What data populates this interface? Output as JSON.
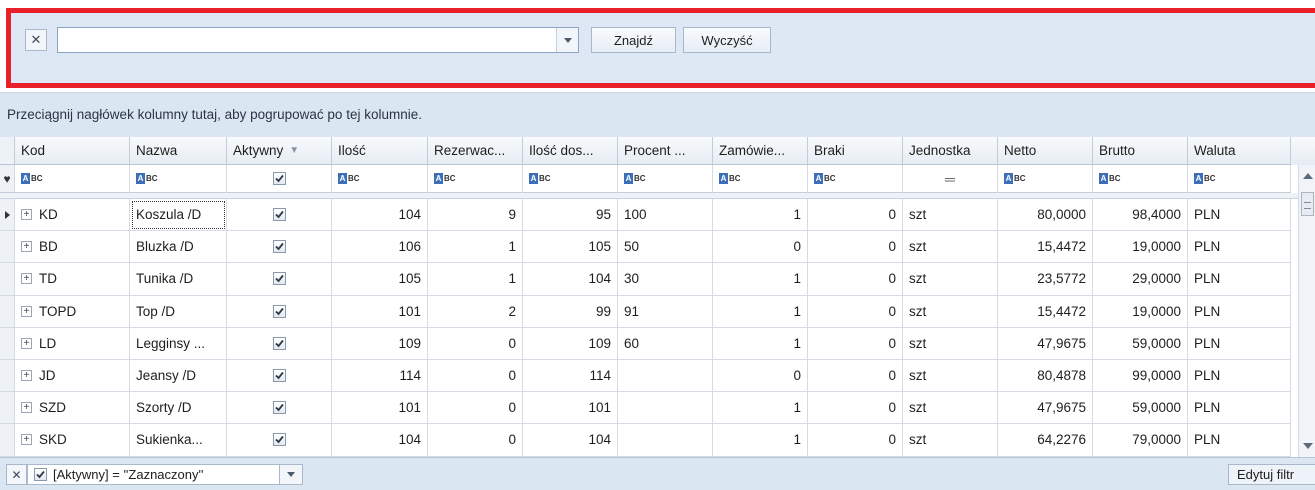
{
  "search": {
    "value": "",
    "find_label": "Znajdź",
    "clear_label": "Wyczyść"
  },
  "group_panel": {
    "hint": "Przeciągnij nagłówek kolumny tutaj, aby pogrupować po tej kolumnie."
  },
  "columns": {
    "kod": "Kod",
    "nazwa": "Nazwa",
    "aktywny": "Aktywny",
    "ilosc": "Ilość",
    "rezerwacje": "Rezerwac...",
    "ilosc_dost": "Ilość dos...",
    "procent": "Procent ...",
    "zamowienia": "Zamówie...",
    "braki": "Braki",
    "jednostka": "Jednostka",
    "netto": "Netto",
    "brutto": "Brutto",
    "waluta": "Waluta"
  },
  "rows": [
    {
      "kod": "KD",
      "nazwa": "Koszula /D",
      "aktywny": true,
      "ilosc": "104",
      "rezerwacje": "9",
      "ilosc_dost": "95",
      "procent": "100",
      "zamowienia": "1",
      "braki": "0",
      "jednostka": "szt",
      "netto": "80,0000",
      "brutto": "98,4000",
      "waluta": "PLN"
    },
    {
      "kod": "BD",
      "nazwa": "Bluzka /D",
      "aktywny": true,
      "ilosc": "106",
      "rezerwacje": "1",
      "ilosc_dost": "105",
      "procent": "50",
      "zamowienia": "0",
      "braki": "0",
      "jednostka": "szt",
      "netto": "15,4472",
      "brutto": "19,0000",
      "waluta": "PLN"
    },
    {
      "kod": "TD",
      "nazwa": "Tunika /D",
      "aktywny": true,
      "ilosc": "105",
      "rezerwacje": "1",
      "ilosc_dost": "104",
      "procent": "30",
      "zamowienia": "1",
      "braki": "0",
      "jednostka": "szt",
      "netto": "23,5772",
      "brutto": "29,0000",
      "waluta": "PLN"
    },
    {
      "kod": "TOPD",
      "nazwa": "Top /D",
      "aktywny": true,
      "ilosc": "101",
      "rezerwacje": "2",
      "ilosc_dost": "99",
      "procent": "91",
      "zamowienia": "1",
      "braki": "0",
      "jednostka": "szt",
      "netto": "15,4472",
      "brutto": "19,0000",
      "waluta": "PLN"
    },
    {
      "kod": "LD",
      "nazwa": "Legginsy ...",
      "aktywny": true,
      "ilosc": "109",
      "rezerwacje": "0",
      "ilosc_dost": "109",
      "procent": "60",
      "zamowienia": "1",
      "braki": "0",
      "jednostka": "szt",
      "netto": "47,9675",
      "brutto": "59,0000",
      "waluta": "PLN"
    },
    {
      "kod": "JD",
      "nazwa": "Jeansy /D",
      "aktywny": true,
      "ilosc": "114",
      "rezerwacje": "0",
      "ilosc_dost": "114",
      "procent": "",
      "zamowienia": "0",
      "braki": "0",
      "jednostka": "szt",
      "netto": "80,4878",
      "brutto": "99,0000",
      "waluta": "PLN"
    },
    {
      "kod": "SZD",
      "nazwa": "Szorty /D",
      "aktywny": true,
      "ilosc": "101",
      "rezerwacje": "0",
      "ilosc_dost": "101",
      "procent": "",
      "zamowienia": "1",
      "braki": "0",
      "jednostka": "szt",
      "netto": "47,9675",
      "brutto": "59,0000",
      "waluta": "PLN"
    },
    {
      "kod": "SKD",
      "nazwa": "Sukienka...",
      "aktywny": true,
      "ilosc": "104",
      "rezerwacje": "0",
      "ilosc_dost": "104",
      "procent": "",
      "zamowienia": "1",
      "braki": "0",
      "jednostka": "szt",
      "netto": "64,2276",
      "brutto": "79,0000",
      "waluta": "PLN"
    }
  ],
  "footer": {
    "filter_text": "[Aktywny] = ''Zaznaczony''",
    "edit_filter_label": "Edytuj filtr"
  },
  "colors": {
    "highlight_border": "#e8202a",
    "panel_bg": "#dee8f5"
  }
}
